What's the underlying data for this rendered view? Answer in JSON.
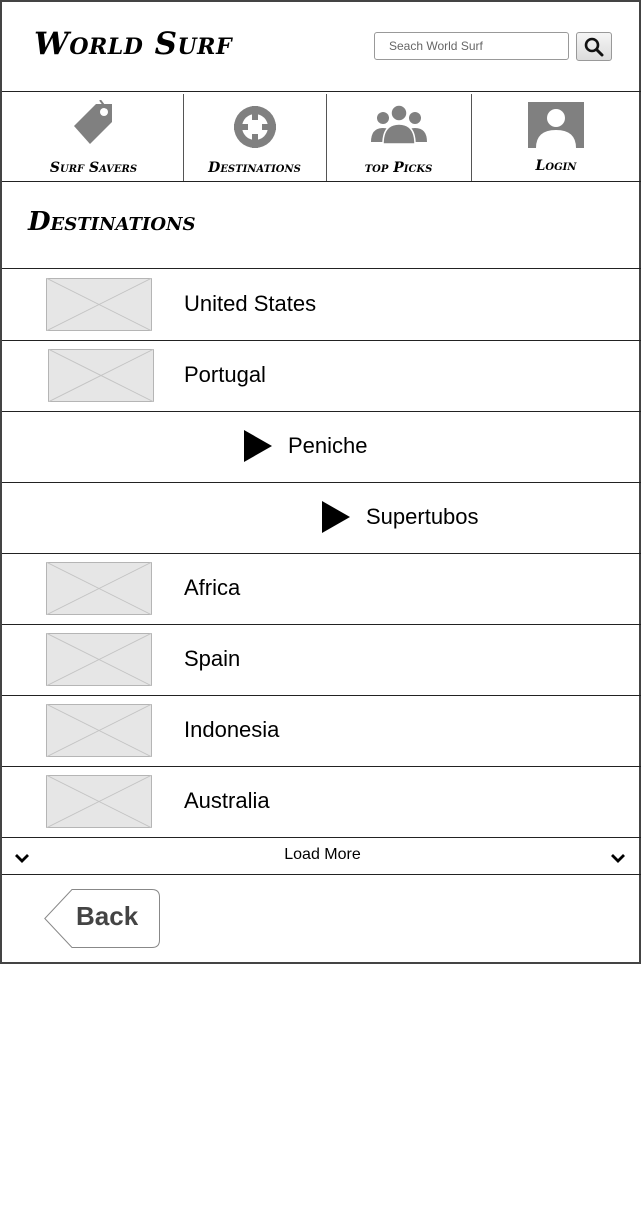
{
  "header": {
    "brand": "World Surf",
    "search_placeholder": "Seach World Surf",
    "search_icon": "search-icon"
  },
  "nav": [
    {
      "label": "Surf Savers",
      "icon": "tag-icon"
    },
    {
      "label": "Destinations",
      "icon": "target-icon"
    },
    {
      "label": "top Picks",
      "icon": "group-icon"
    },
    {
      "label": "Login",
      "icon": "user-avatar-icon"
    }
  ],
  "page_title": "Destinations",
  "list": {
    "items": [
      {
        "label": "United States",
        "type": "image"
      },
      {
        "label": "Portugal",
        "type": "image"
      },
      {
        "label": "Peniche",
        "type": "arrow"
      },
      {
        "label": "Supertubos",
        "type": "arrow"
      },
      {
        "label": "Africa",
        "type": "image"
      },
      {
        "label": "Spain",
        "type": "image"
      },
      {
        "label": "Indonesia",
        "type": "image"
      },
      {
        "label": "Australia",
        "type": "image"
      }
    ],
    "load_more": "Load More"
  },
  "back_label": "Back",
  "colors": {
    "icon_gray": "#808080",
    "placeholder_fill": "#e6e6e6",
    "border": "#222222"
  }
}
